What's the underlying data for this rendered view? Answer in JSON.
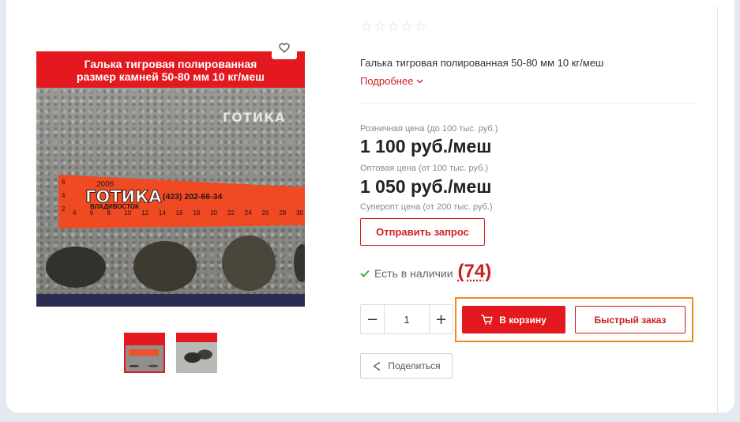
{
  "product": {
    "image": {
      "banner_line_1": "Галька тигровая полированная",
      "banner_line_2": "размер камней 50-80 мм 10 кг/меш",
      "watermark": "ГОТИКА",
      "ruler_year": "2006",
      "ruler_brand": "ГОТИКА",
      "ruler_phone": "(423) 202-66-34",
      "ruler_city": "ВЛАДИВОСТОК",
      "ruler_ticks": [
        "4",
        "6",
        "8",
        "10",
        "12",
        "14",
        "16",
        "18",
        "20",
        "22",
        "24",
        "26",
        "28",
        "30"
      ],
      "ruler_side_ticks": [
        "6",
        "4",
        "2"
      ]
    },
    "thumbnails": [
      {
        "name": "thumb-1",
        "selected": true
      },
      {
        "name": "thumb-2",
        "selected": false
      }
    ],
    "rating_stars": [
      "☆",
      "☆",
      "☆",
      "☆",
      "☆"
    ],
    "rating": 0,
    "description": "Галька тигровая полированная 50-80 мм 10 кг/меш",
    "more_link": "Подробнее"
  },
  "prices": [
    {
      "label": "Розничная цена (до 100 тыс. руб.)",
      "value": "1 100 руб./меш"
    },
    {
      "label": "Оптовая цена (от 100 тыс. руб.)",
      "value": "1 050 руб./меш"
    },
    {
      "label": "Суперопт цена (от 200 тыс. руб.)",
      "value": ""
    }
  ],
  "actions": {
    "request_label": "Отправить запрос",
    "stock_label": "Есть в наличии",
    "stock_count": "(74)",
    "quantity": "1",
    "qty_minus": "−",
    "qty_plus": "+",
    "add_to_cart_label": "В корзину",
    "quick_order_label": "Быстрый заказ",
    "share_label": "Поделиться"
  },
  "colors": {
    "accent_red": "#e3191f",
    "stock_green": "#3cb04b",
    "highlight_orange": "#f08a1c"
  },
  "icons": {
    "favorite": "heart-icon",
    "rating": "star-icon",
    "more": "chevron-down-icon",
    "in_stock": "check-icon",
    "cart": "cart-icon",
    "share": "share-icon"
  }
}
